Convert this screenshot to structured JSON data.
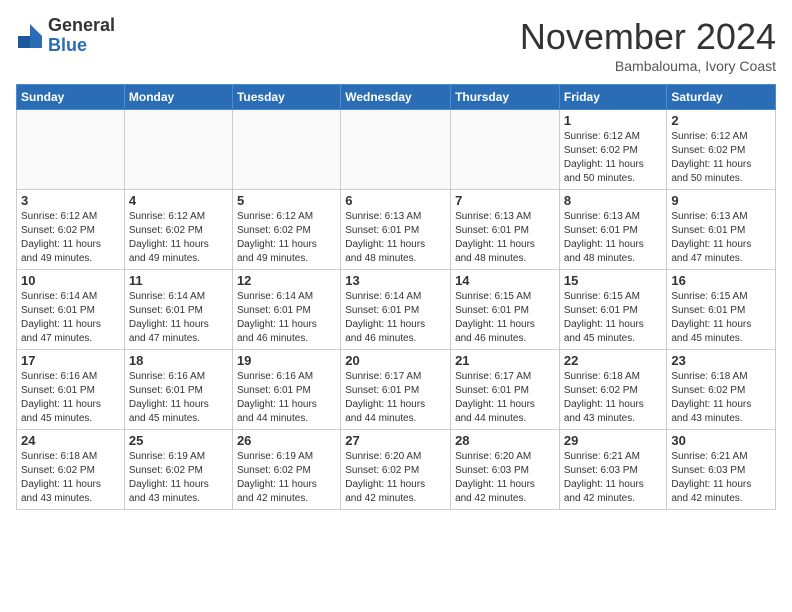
{
  "logo": {
    "general": "General",
    "blue": "Blue"
  },
  "header": {
    "month": "November 2024",
    "location": "Bambalouma, Ivory Coast"
  },
  "weekdays": [
    "Sunday",
    "Monday",
    "Tuesday",
    "Wednesday",
    "Thursday",
    "Friday",
    "Saturday"
  ],
  "weeks": [
    [
      {
        "day": "",
        "info": ""
      },
      {
        "day": "",
        "info": ""
      },
      {
        "day": "",
        "info": ""
      },
      {
        "day": "",
        "info": ""
      },
      {
        "day": "",
        "info": ""
      },
      {
        "day": "1",
        "info": "Sunrise: 6:12 AM\nSunset: 6:02 PM\nDaylight: 11 hours\nand 50 minutes."
      },
      {
        "day": "2",
        "info": "Sunrise: 6:12 AM\nSunset: 6:02 PM\nDaylight: 11 hours\nand 50 minutes."
      }
    ],
    [
      {
        "day": "3",
        "info": "Sunrise: 6:12 AM\nSunset: 6:02 PM\nDaylight: 11 hours\nand 49 minutes."
      },
      {
        "day": "4",
        "info": "Sunrise: 6:12 AM\nSunset: 6:02 PM\nDaylight: 11 hours\nand 49 minutes."
      },
      {
        "day": "5",
        "info": "Sunrise: 6:12 AM\nSunset: 6:02 PM\nDaylight: 11 hours\nand 49 minutes."
      },
      {
        "day": "6",
        "info": "Sunrise: 6:13 AM\nSunset: 6:01 PM\nDaylight: 11 hours\nand 48 minutes."
      },
      {
        "day": "7",
        "info": "Sunrise: 6:13 AM\nSunset: 6:01 PM\nDaylight: 11 hours\nand 48 minutes."
      },
      {
        "day": "8",
        "info": "Sunrise: 6:13 AM\nSunset: 6:01 PM\nDaylight: 11 hours\nand 48 minutes."
      },
      {
        "day": "9",
        "info": "Sunrise: 6:13 AM\nSunset: 6:01 PM\nDaylight: 11 hours\nand 47 minutes."
      }
    ],
    [
      {
        "day": "10",
        "info": "Sunrise: 6:14 AM\nSunset: 6:01 PM\nDaylight: 11 hours\nand 47 minutes."
      },
      {
        "day": "11",
        "info": "Sunrise: 6:14 AM\nSunset: 6:01 PM\nDaylight: 11 hours\nand 47 minutes."
      },
      {
        "day": "12",
        "info": "Sunrise: 6:14 AM\nSunset: 6:01 PM\nDaylight: 11 hours\nand 46 minutes."
      },
      {
        "day": "13",
        "info": "Sunrise: 6:14 AM\nSunset: 6:01 PM\nDaylight: 11 hours\nand 46 minutes."
      },
      {
        "day": "14",
        "info": "Sunrise: 6:15 AM\nSunset: 6:01 PM\nDaylight: 11 hours\nand 46 minutes."
      },
      {
        "day": "15",
        "info": "Sunrise: 6:15 AM\nSunset: 6:01 PM\nDaylight: 11 hours\nand 45 minutes."
      },
      {
        "day": "16",
        "info": "Sunrise: 6:15 AM\nSunset: 6:01 PM\nDaylight: 11 hours\nand 45 minutes."
      }
    ],
    [
      {
        "day": "17",
        "info": "Sunrise: 6:16 AM\nSunset: 6:01 PM\nDaylight: 11 hours\nand 45 minutes."
      },
      {
        "day": "18",
        "info": "Sunrise: 6:16 AM\nSunset: 6:01 PM\nDaylight: 11 hours\nand 45 minutes."
      },
      {
        "day": "19",
        "info": "Sunrise: 6:16 AM\nSunset: 6:01 PM\nDaylight: 11 hours\nand 44 minutes."
      },
      {
        "day": "20",
        "info": "Sunrise: 6:17 AM\nSunset: 6:01 PM\nDaylight: 11 hours\nand 44 minutes."
      },
      {
        "day": "21",
        "info": "Sunrise: 6:17 AM\nSunset: 6:01 PM\nDaylight: 11 hours\nand 44 minutes."
      },
      {
        "day": "22",
        "info": "Sunrise: 6:18 AM\nSunset: 6:02 PM\nDaylight: 11 hours\nand 43 minutes."
      },
      {
        "day": "23",
        "info": "Sunrise: 6:18 AM\nSunset: 6:02 PM\nDaylight: 11 hours\nand 43 minutes."
      }
    ],
    [
      {
        "day": "24",
        "info": "Sunrise: 6:18 AM\nSunset: 6:02 PM\nDaylight: 11 hours\nand 43 minutes."
      },
      {
        "day": "25",
        "info": "Sunrise: 6:19 AM\nSunset: 6:02 PM\nDaylight: 11 hours\nand 43 minutes."
      },
      {
        "day": "26",
        "info": "Sunrise: 6:19 AM\nSunset: 6:02 PM\nDaylight: 11 hours\nand 42 minutes."
      },
      {
        "day": "27",
        "info": "Sunrise: 6:20 AM\nSunset: 6:02 PM\nDaylight: 11 hours\nand 42 minutes."
      },
      {
        "day": "28",
        "info": "Sunrise: 6:20 AM\nSunset: 6:03 PM\nDaylight: 11 hours\nand 42 minutes."
      },
      {
        "day": "29",
        "info": "Sunrise: 6:21 AM\nSunset: 6:03 PM\nDaylight: 11 hours\nand 42 minutes."
      },
      {
        "day": "30",
        "info": "Sunrise: 6:21 AM\nSunset: 6:03 PM\nDaylight: 11 hours\nand 42 minutes."
      }
    ]
  ]
}
